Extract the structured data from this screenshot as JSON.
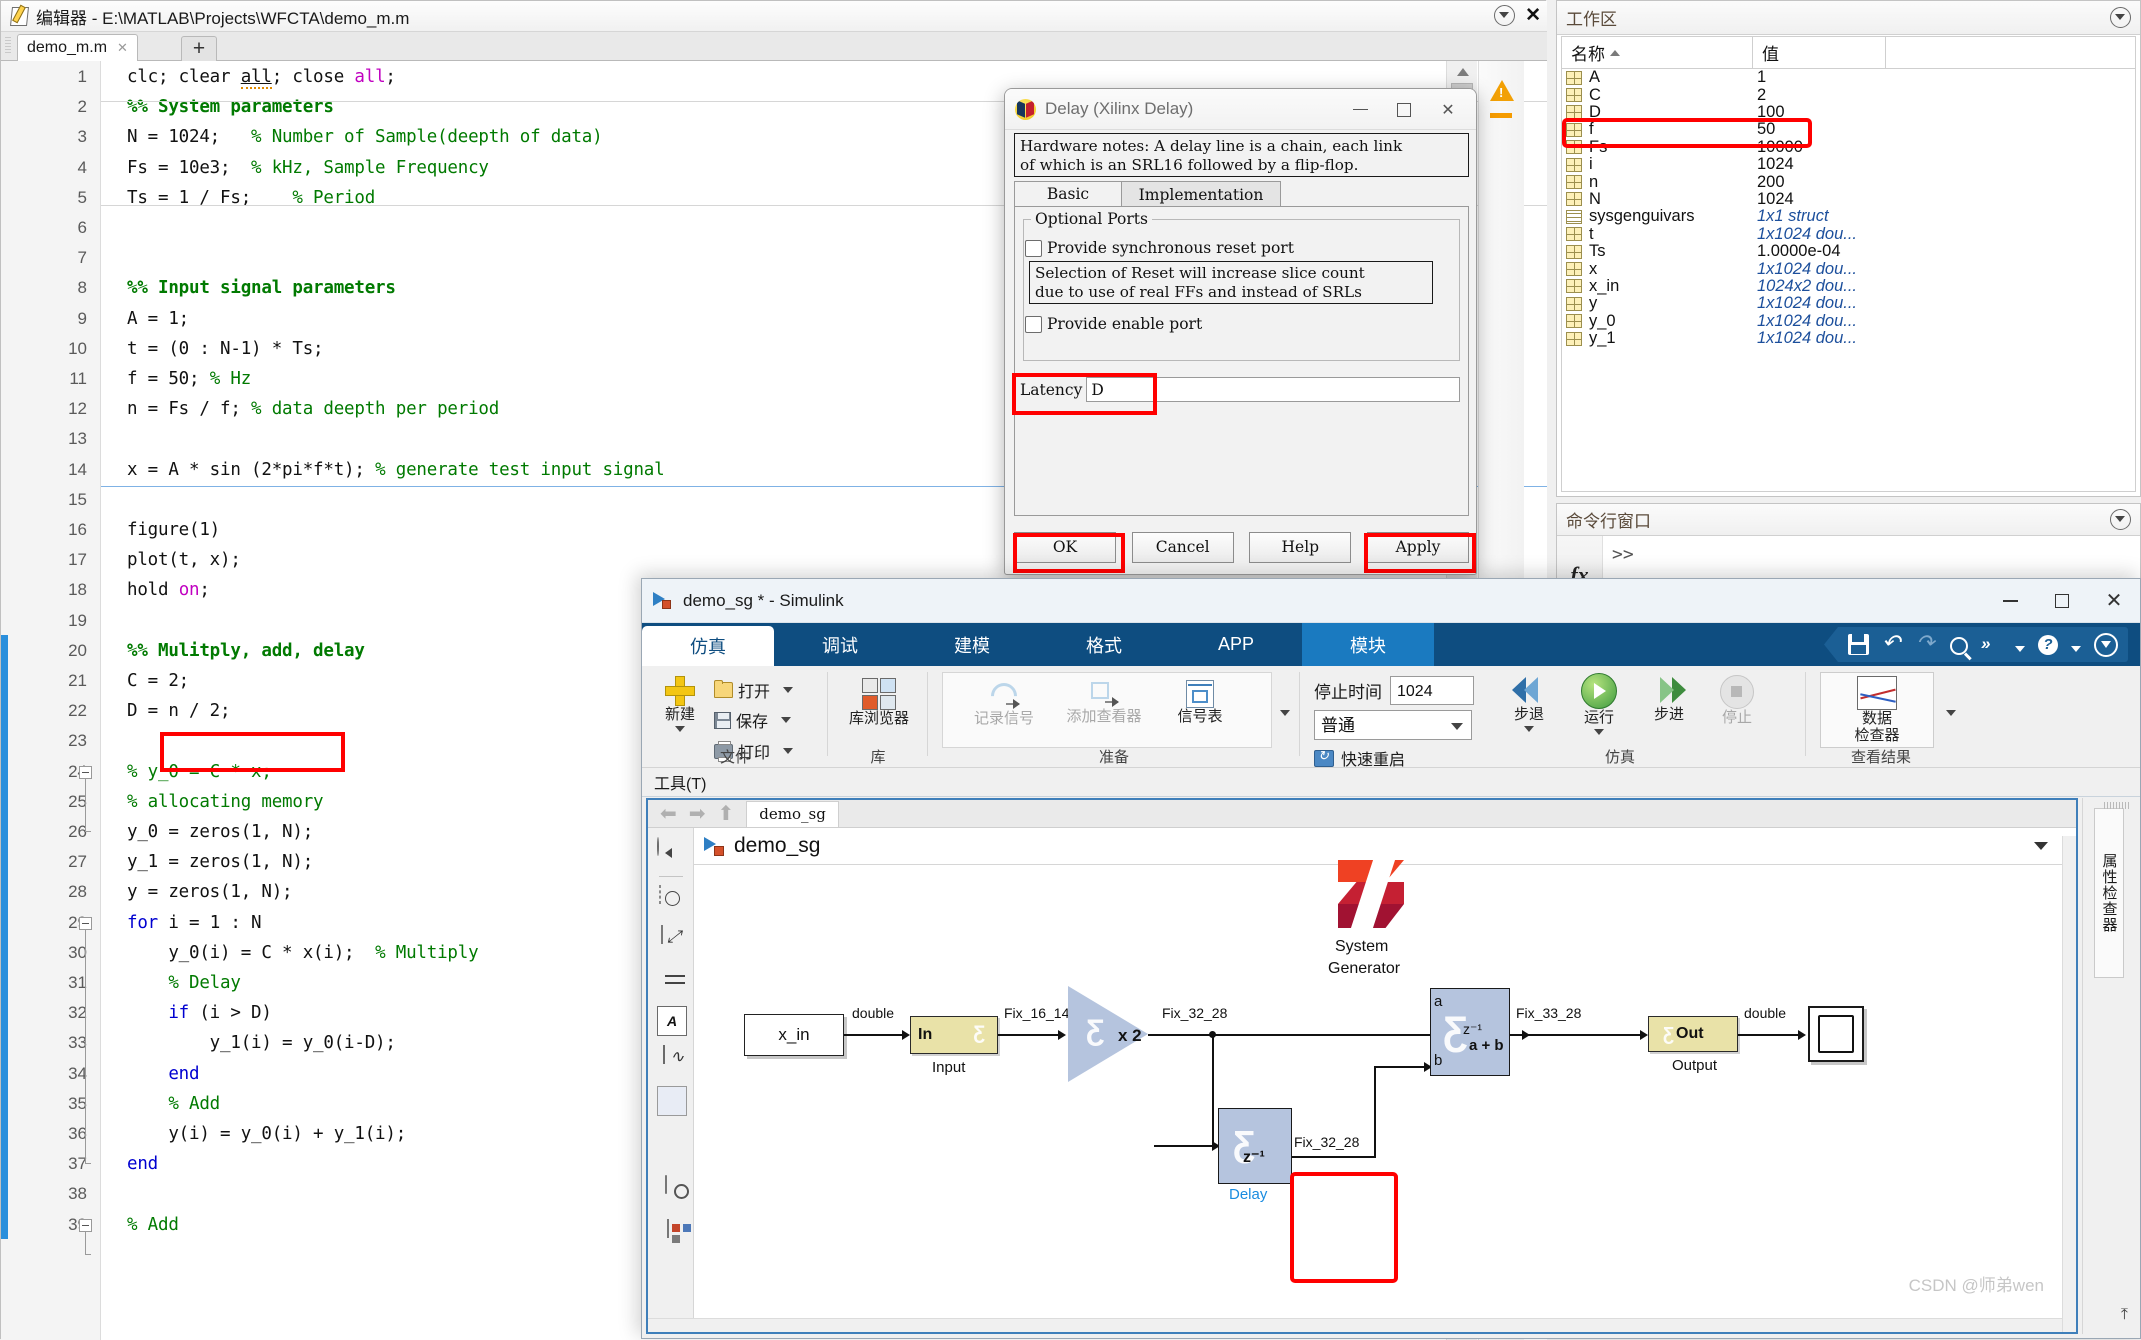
{
  "editor": {
    "title": "编辑器 - E:\\MATLAB\\Projects\\WFCTA\\demo_m.m",
    "tab_label": "demo_m.m",
    "tab_close": "✕",
    "new_tab": "+",
    "collapse_icon": "collapse-caret",
    "close_icon": "✕",
    "code_lines": [
      {
        "n": 1,
        "html": "clc; clear <u class=\"squig\">all</u>; close <span class=\"pk\">all</span>;"
      },
      {
        "n": 2,
        "html": "<span class=\"cmb\">%% System parameters</span>"
      },
      {
        "n": 3,
        "html": "N = 1024;   <span class=\"cm\">% Number of Sample(deepth of data)</span>"
      },
      {
        "n": 4,
        "html": "Fs = 10e3;  <span class=\"cm\">% kHz, Sample Frequency</span>"
      },
      {
        "n": 5,
        "html": "Ts = 1 / Fs;    <span class=\"cm\">% Period</span>"
      },
      {
        "n": 6,
        "html": ""
      },
      {
        "n": 7,
        "html": ""
      },
      {
        "n": 8,
        "html": "<span class=\"cmb\">%% Input signal parameters</span>"
      },
      {
        "n": 9,
        "html": "A = 1;"
      },
      {
        "n": 10,
        "html": "t = (0 : N-1) * Ts;"
      },
      {
        "n": 11,
        "html": "f = 50; <span class=\"cm\">% Hz</span>"
      },
      {
        "n": 12,
        "html": "n = Fs / f; <span class=\"cm\">% data deepth per period</span>"
      },
      {
        "n": 13,
        "html": ""
      },
      {
        "n": 14,
        "html": "x = A * sin (2*pi*f*t); <span class=\"cm\">% generate test input signal</span>"
      },
      {
        "n": 15,
        "html": ""
      },
      {
        "n": 16,
        "html": "figure(1)"
      },
      {
        "n": 17,
        "html": "plot(t, x);"
      },
      {
        "n": 18,
        "html": "hold <span class=\"pk\">on</span>;"
      },
      {
        "n": 19,
        "html": ""
      },
      {
        "n": 20,
        "html": "<span class=\"cmb\">%% Mulitply, add, delay</span>"
      },
      {
        "n": 21,
        "html": "C = 2;"
      },
      {
        "n": 22,
        "html": "D = n / 2;"
      },
      {
        "n": 23,
        "html": ""
      },
      {
        "n": 24,
        "html": "<span class=\"cm\">% y_0 = C * x;</span>"
      },
      {
        "n": 25,
        "html": "<span class=\"cm\">% allocating memory</span>"
      },
      {
        "n": 26,
        "html": "y_0 = zeros(1, N);"
      },
      {
        "n": 27,
        "html": "y_1 = zeros(1, N);"
      },
      {
        "n": 28,
        "html": "y = zeros(1, N);"
      },
      {
        "n": 29,
        "html": "<span class=\"kw\">for</span> i = 1 : N"
      },
      {
        "n": 30,
        "html": "    y_0(i) = C * x(i);  <span class=\"cm\">% Multiply</span>"
      },
      {
        "n": 31,
        "html": "    <span class=\"cm\">% Delay</span>"
      },
      {
        "n": 32,
        "html": "    <span class=\"kw\">if</span> (i &gt; D)"
      },
      {
        "n": 33,
        "html": "        y_1(i) = y_0(i-D);"
      },
      {
        "n": 34,
        "html": "    <span class=\"kw\">end</span>"
      },
      {
        "n": 35,
        "html": "    <span class=\"cm\">% Add</span>"
      },
      {
        "n": 36,
        "html": "    y(i) = y_0(i) + y_1(i);"
      },
      {
        "n": 37,
        "html": "<span class=\"kw\">end</span>"
      },
      {
        "n": 38,
        "html": ""
      },
      {
        "n": 39,
        "html": "<span class=\"cm\">% Add</span>"
      }
    ],
    "highlighted_line": 22,
    "warning_icon": "warning-triangle"
  },
  "workspace": {
    "title": "工作区",
    "columns": [
      "名称",
      "值"
    ],
    "rows": [
      {
        "name": "A",
        "value": "1",
        "type": "array"
      },
      {
        "name": "C",
        "value": "2",
        "type": "array"
      },
      {
        "name": "D",
        "value": "100",
        "type": "array",
        "highlighted": true
      },
      {
        "name": "f",
        "value": "50",
        "type": "array"
      },
      {
        "name": "Fs",
        "value": "10000",
        "type": "array"
      },
      {
        "name": "i",
        "value": "1024",
        "type": "array"
      },
      {
        "name": "n",
        "value": "200",
        "type": "array"
      },
      {
        "name": "N",
        "value": "1024",
        "type": "array"
      },
      {
        "name": "sysgenguivars",
        "value": "1x1 struct",
        "type": "struct",
        "dim": true
      },
      {
        "name": "t",
        "value": "1x1024 dou...",
        "type": "array",
        "dim": true
      },
      {
        "name": "Ts",
        "value": "1.0000e-04",
        "type": "array"
      },
      {
        "name": "x",
        "value": "1x1024 dou...",
        "type": "array",
        "dim": true
      },
      {
        "name": "x_in",
        "value": "1024x2 dou...",
        "type": "array",
        "dim": true
      },
      {
        "name": "y",
        "value": "1x1024 dou...",
        "type": "array",
        "dim": true
      },
      {
        "name": "y_0",
        "value": "1x1024 dou...",
        "type": "array",
        "dim": true
      },
      {
        "name": "y_1",
        "value": "1x1024 dou...",
        "type": "array",
        "dim": true
      }
    ]
  },
  "command_window": {
    "title": "命令行窗口",
    "fx_label": "fx",
    "prompt": ">>"
  },
  "delay_dialog": {
    "title": "Delay (Xilinx Delay)",
    "hardware_note": "Hardware notes: A delay line is a chain, each link\nof which is an SRL16 followed by a flip-flop.",
    "tabs": [
      {
        "label": "Basic",
        "active": true
      },
      {
        "label": "Implementation",
        "active": false
      }
    ],
    "group_label": "Optional Ports",
    "checkbox_reset": "Provide synchronous reset port",
    "reset_note": "Selection of Reset will increase slice count\ndue to use of real FFs and instead of SRLs",
    "checkbox_enable": "Provide enable port",
    "latency_label": "Latency",
    "latency_value": "D",
    "buttons": [
      {
        "label": "OK",
        "highlighted": true
      },
      {
        "label": "Cancel",
        "highlighted": false
      },
      {
        "label": "Help",
        "highlighted": false
      },
      {
        "label": "Apply",
        "highlighted": true
      }
    ],
    "window_buttons": {
      "minimize": "—",
      "maximize": "□",
      "close": "✕"
    }
  },
  "simulink": {
    "title": "demo_sg * - Simulink",
    "window_buttons": {
      "minimize": "—",
      "maximize": "□",
      "close": "✕"
    },
    "ribbon_tabs": [
      {
        "label": "仿真",
        "state": "active"
      },
      {
        "label": "调试",
        "state": "normal"
      },
      {
        "label": "建模",
        "state": "normal"
      },
      {
        "label": "格式",
        "state": "normal"
      },
      {
        "label": "APP",
        "state": "normal"
      },
      {
        "label": "模块",
        "state": "selected"
      }
    ],
    "quick_access": [
      "save-icon",
      "undo-icon",
      "redo-icon",
      "search-icon",
      "convert-icon",
      "convert-caret-icon",
      "help-icon",
      "help-caret-icon",
      "oval-caret-icon"
    ],
    "groups": {
      "file": {
        "label": "文件",
        "new_label": "新建",
        "items": [
          {
            "label": "打开",
            "icon": "folder-icon"
          },
          {
            "label": "保存",
            "icon": "disk-icon"
          },
          {
            "label": "打印",
            "icon": "printer-icon"
          }
        ]
      },
      "library": {
        "label": "库",
        "button": "库浏览器"
      },
      "prepare": {
        "label": "准备",
        "items": [
          {
            "label": "记录信号",
            "disabled": true
          },
          {
            "label": "添加查看器",
            "disabled": true
          },
          {
            "label": "信号表",
            "disabled": false
          }
        ]
      },
      "simulate": {
        "label": "仿真",
        "stop_time_label": "停止时间",
        "stop_time_value": "1024",
        "mode_value": "普通",
        "fast_restart": "快速重启",
        "buttons": [
          {
            "label": "步退",
            "icon": "step-back-icon"
          },
          {
            "label": "运行",
            "icon": "run-icon"
          },
          {
            "label": "步进",
            "icon": "step-forward-icon"
          },
          {
            "label": "停止",
            "icon": "stop-icon",
            "disabled": true
          }
        ]
      },
      "results": {
        "label": "查看结果",
        "inspector_label_1": "数据",
        "inspector_label_2": "检查器"
      }
    },
    "tools_menu": "工具(T)",
    "breadcrumb_tab": "demo_sg",
    "canvas_title": "demo_sg",
    "left_toolbar": [
      "back-icon",
      "zoom-region-icon",
      "fit-to-view-icon",
      "arrange-icon",
      "annotation-icon",
      "scope-icon",
      "blank-block-icon",
      "camera-icon",
      "report-icon"
    ],
    "property_inspector_label": "属性检查器",
    "watermark": "CSDN @师弟wen"
  },
  "diagram": {
    "blocks": [
      {
        "id": "x_in",
        "label": "x_in",
        "kind": "from-workspace"
      },
      {
        "id": "gateway_in",
        "label": "In",
        "sublabel": "Input",
        "kind": "xilinx-gateway-in"
      },
      {
        "id": "mult",
        "label": "x 2",
        "kind": "xilinx-cmult"
      },
      {
        "id": "sysgen",
        "label_1": "System",
        "label_2": "Generator",
        "kind": "xilinx-system-generator"
      },
      {
        "id": "delay",
        "label": "Delay",
        "symbol": "z⁻¹",
        "kind": "xilinx-delay",
        "highlighted": true,
        "selected": true
      },
      {
        "id": "adder",
        "label": "a + b",
        "port_a": "a",
        "port_b": "b",
        "symbol": "z⁻¹",
        "kind": "xilinx-addsub"
      },
      {
        "id": "gateway_out",
        "label": "Out",
        "sublabel": "Output",
        "kind": "xilinx-gateway-out"
      },
      {
        "id": "scope",
        "label": "",
        "kind": "scope"
      }
    ],
    "signal_labels": [
      {
        "text": "double",
        "for": "x_in->gateway_in"
      },
      {
        "text": "Fix_16_14",
        "for": "gateway_in->mult"
      },
      {
        "text": "Fix_32_28",
        "for": "mult->adder"
      },
      {
        "text": "Fix_32_28",
        "for": "delay->adder_b"
      },
      {
        "text": "Fix_33_28",
        "for": "adder->gateway_out"
      },
      {
        "text": "double",
        "for": "gateway_out->scope"
      }
    ]
  }
}
